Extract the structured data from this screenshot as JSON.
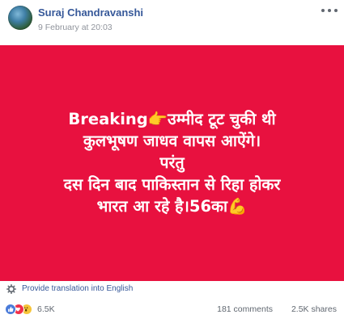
{
  "post": {
    "author": "Suraj Chandravanshi",
    "timestamp": "9 February at 20:03"
  },
  "banner": {
    "background_color": "#e8113f",
    "line1": "Breaking👉उम्मीद टूट चुकी थी",
    "line2": "कुलभूषण जाधव वापस आऐंगे।",
    "line3": "परंतु",
    "line4": "दस दिन बाद पाकिस्तान से रिहा होकर",
    "line5": "भारत आ रहे है।56का💪"
  },
  "translate": {
    "icon": "gear-icon",
    "label": "Provide translation into English"
  },
  "engagement": {
    "reaction_icons": [
      "like-icon",
      "love-icon",
      "wow-icon"
    ],
    "reactions": "6.5K",
    "comments": "181 comments",
    "shares": "2.5K shares"
  }
}
